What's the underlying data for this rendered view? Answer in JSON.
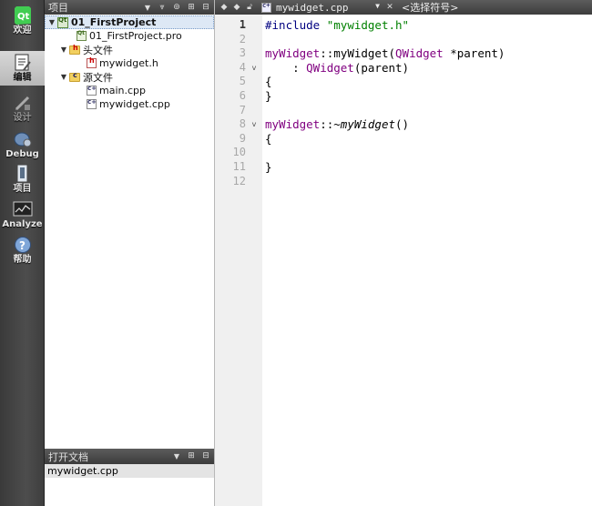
{
  "modebar": {
    "items": [
      {
        "label": "欢迎",
        "icon": "qt-logo-icon",
        "state": "normal"
      },
      {
        "label": "编辑",
        "icon": "edit-document-icon",
        "state": "active"
      },
      {
        "label": "设计",
        "icon": "design-pen-icon",
        "state": "disabled"
      },
      {
        "label": "Debug",
        "icon": "debug-bug-icon",
        "state": "normal"
      },
      {
        "label": "项目",
        "icon": "project-wrench-icon",
        "state": "normal"
      },
      {
        "label": "Analyze",
        "icon": "analyze-monitor-icon",
        "state": "normal"
      },
      {
        "label": "帮助",
        "icon": "help-question-icon",
        "state": "normal"
      }
    ]
  },
  "project_panel": {
    "title": "项目",
    "tree": [
      {
        "label": "01_FirstProject",
        "type": "project",
        "level": 0,
        "expanded": true,
        "selected": true
      },
      {
        "label": "01_FirstProject.pro",
        "type": "pro-file",
        "level": 1
      },
      {
        "label": "头文件",
        "type": "header-folder",
        "level": 1,
        "expanded": true
      },
      {
        "label": "mywidget.h",
        "type": "header-file",
        "level": 2
      },
      {
        "label": "源文件",
        "type": "source-folder",
        "level": 1,
        "expanded": true
      },
      {
        "label": "main.cpp",
        "type": "cpp-file",
        "level": 2
      },
      {
        "label": "mywidget.cpp",
        "type": "cpp-file",
        "level": 2
      }
    ]
  },
  "open_docs": {
    "title": "打开文档",
    "items": [
      "mywidget.cpp"
    ]
  },
  "editor": {
    "file_name": "mywidget.cpp",
    "symbol_placeholder": "<选择符号>",
    "current_line": 1,
    "lines": [
      {
        "n": "1",
        "fold": ""
      },
      {
        "n": "2",
        "fold": ""
      },
      {
        "n": "3",
        "fold": ""
      },
      {
        "n": "4",
        "fold": "v"
      },
      {
        "n": "5",
        "fold": ""
      },
      {
        "n": "6",
        "fold": ""
      },
      {
        "n": "7",
        "fold": ""
      },
      {
        "n": "8",
        "fold": "v"
      },
      {
        "n": "9",
        "fold": ""
      },
      {
        "n": "10",
        "fold": ""
      },
      {
        "n": "11",
        "fold": ""
      },
      {
        "n": "12",
        "fold": ""
      }
    ],
    "code": {
      "l1_pp": "#include",
      "l1_str": "\"mywidget.h\"",
      "l3_cls1": "myWidget",
      "l3_mid": "::myWidget(",
      "l3_cls2": "QWidget",
      "l3_end": " *parent)",
      "l4_pre": "    : ",
      "l4_cls": "QWidget",
      "l4_end": "(parent)",
      "l5": "{",
      "l6": "}",
      "l8_cls": "myWidget",
      "l8_mid": "::~",
      "l8_it": "myWidget",
      "l8_end": "()",
      "l9": "{",
      "l11": "}"
    }
  },
  "colors": {
    "preprocessor": "#000080",
    "string": "#008000",
    "class": "#800080",
    "panel_header": "#4a4a4a"
  }
}
